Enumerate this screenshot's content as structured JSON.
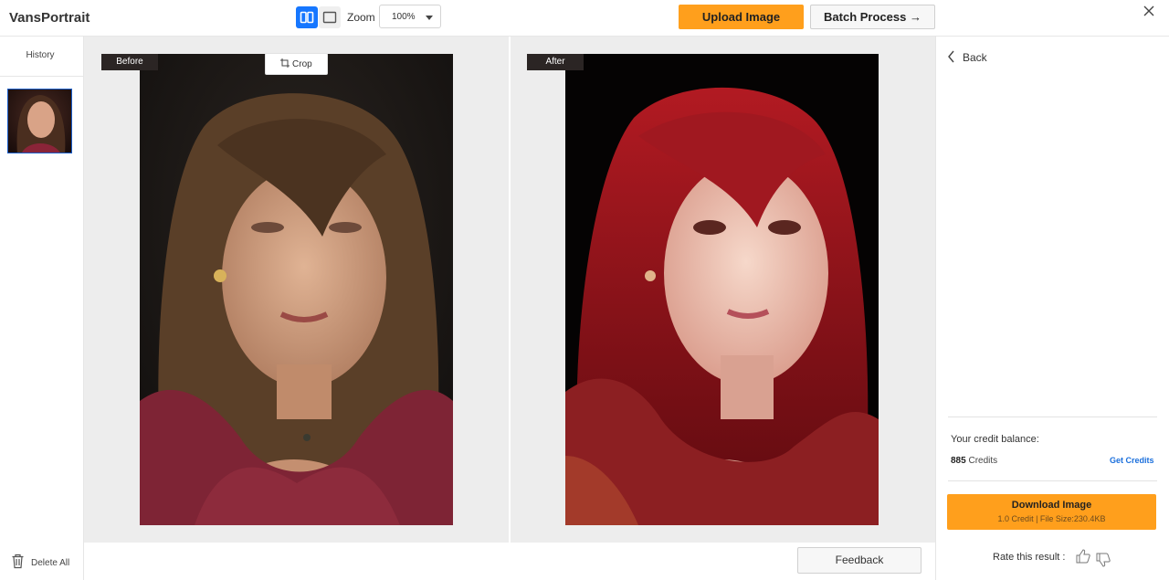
{
  "app": {
    "title": "VansPortrait"
  },
  "toolbar": {
    "zoom_label": "Zoom",
    "zoom_value": "100%",
    "upload_label": "Upload Image",
    "batch_label": "Batch Process →"
  },
  "history": {
    "title": "History",
    "delete_all_label": "Delete All"
  },
  "canvas": {
    "before_label": "Before",
    "after_label": "After",
    "crop_label": "Crop"
  },
  "right": {
    "back_label": "Back",
    "credit_balance_label": "Your credit balance:",
    "credit_count": "885",
    "credit_unit": "Credits",
    "get_credits_label": "Get Credits",
    "download_label": "Download Image",
    "download_sub": "1.0 Credit | File Size:230.4KB",
    "rate_label": "Rate this result :"
  },
  "footer": {
    "feedback_label": "Feedback"
  },
  "colors": {
    "accent_orange": "#ff9f1c",
    "accent_blue": "#1677ff",
    "link_blue": "#1a6fdc"
  }
}
